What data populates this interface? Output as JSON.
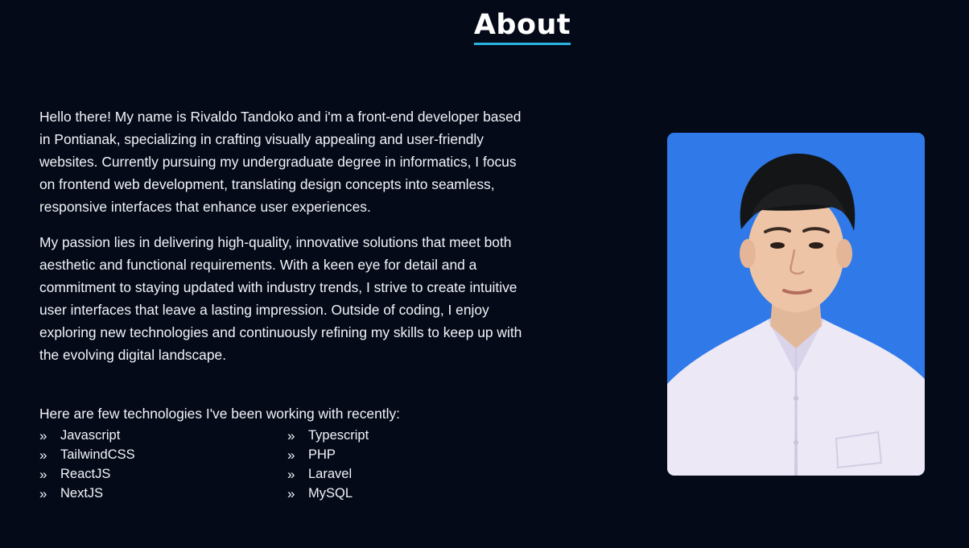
{
  "section": {
    "title": "About"
  },
  "about": {
    "paragraphs": [
      "Hello there! My name is Rivaldo Tandoko and i'm a front-end developer based in Pontianak, specializing in crafting visually appealing and user-friendly websites. Currently pursuing my undergraduate degree in informatics, I focus on frontend web development, translating design concepts into seamless, responsive interfaces that enhance user experiences.",
      "My passion lies in delivering high-quality, innovative solutions that meet both aesthetic and functional requirements. With a keen eye for detail and a commitment to staying updated with industry trends, I strive to create intuitive user interfaces that leave a lasting impression. Outside of coding, I enjoy exploring new technologies and continuously refining my skills to keep up with the evolving digital landscape."
    ],
    "tech_intro": "Here are few technologies I've been working with recently:",
    "technologies": [
      "Javascript",
      "Typescript",
      "TailwindCSS",
      "PHP",
      "ReactJS",
      "Laravel",
      "NextJS",
      "MySQL"
    ]
  },
  "icons": {
    "bullet": "chevron-double-right-icon"
  },
  "colors": {
    "background": "#050a19",
    "accent_underline": "#2bb3e0",
    "text": "#f2f4f8",
    "photo_background": "#2f79e8"
  }
}
